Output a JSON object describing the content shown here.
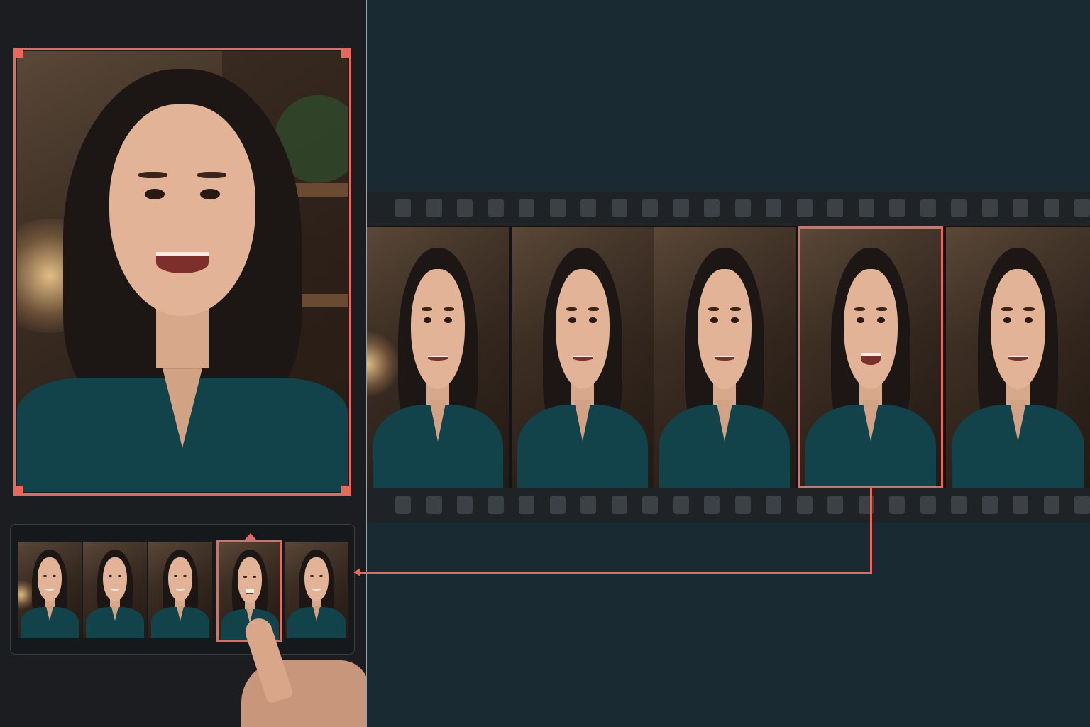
{
  "app": {
    "accent_color": "#e8685c",
    "panel_background": "#1b1d20",
    "workspace_background": "#1a2a33"
  },
  "preview": {
    "selected_frame_index": 3,
    "subject_expression": "laughing"
  },
  "thumbnail_tray": {
    "frames": [
      {
        "expression": "talking"
      },
      {
        "expression": "smiling"
      },
      {
        "expression": "smiling"
      },
      {
        "expression": "laughing"
      },
      {
        "expression": "talking"
      }
    ],
    "selected_index": 3
  },
  "filmstrip": {
    "frames": [
      {
        "expression": "talking"
      },
      {
        "expression": "smiling"
      },
      {
        "expression": "smiling"
      },
      {
        "expression": "laughing"
      },
      {
        "expression": "talking"
      }
    ],
    "selected_index": 3
  },
  "icons": {
    "pointer": "pointing-hand-icon",
    "selection_corner": "crop-corner-icon",
    "connector_arrow": "arrow-left-icon",
    "caret": "caret-up-icon"
  }
}
